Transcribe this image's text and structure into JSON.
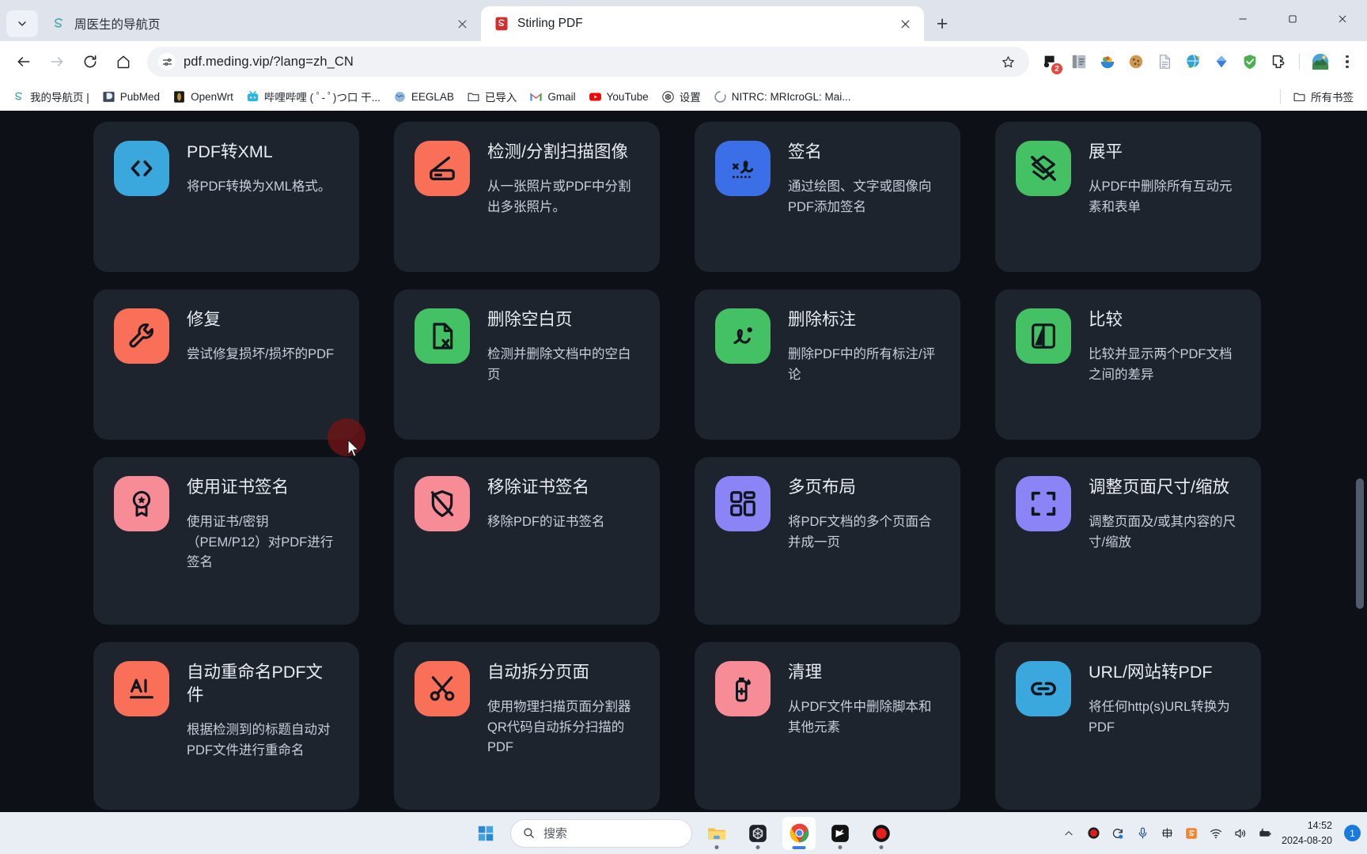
{
  "window": {
    "tabs": [
      {
        "title": "周医生的导航页",
        "favicon": "stirling-s-icon",
        "active": false
      },
      {
        "title": "Stirling PDF",
        "favicon": "stirling-pdf-icon",
        "active": true
      }
    ],
    "new_tab_label": "+",
    "controls": {
      "minimize": "minimize",
      "maximize": "maximize",
      "close": "close"
    }
  },
  "toolbar": {
    "back": "back-arrow",
    "forward": "forward-arrow",
    "reload": "reload",
    "home": "home",
    "url": "pdf.meding.vip/?lang=zh_CN",
    "site_settings_icon": "tune-icon",
    "bookmark_star": "star-icon",
    "extensions": [
      {
        "name": "downloads-badge-icon",
        "badge": "2"
      },
      {
        "name": "copy-pages-icon",
        "badge": ""
      },
      {
        "name": "fruit-bowl-icon",
        "badge": ""
      },
      {
        "name": "cookie-icon",
        "badge": ""
      },
      {
        "name": "document-icon",
        "badge": ""
      },
      {
        "name": "idm-icon",
        "badge": ""
      },
      {
        "name": "diamond-icon",
        "badge": ""
      },
      {
        "name": "adguard-shield-icon",
        "badge": ""
      },
      {
        "name": "extensions-puzzle-icon",
        "badge": ""
      },
      {
        "name": "profile-avatar",
        "badge": ""
      }
    ],
    "menu": "chrome-menu"
  },
  "bookmarks": {
    "items": [
      {
        "label": "我的导航页 |",
        "icon": "stirling-s-icon"
      },
      {
        "label": "PubMed",
        "icon": "pubmed-icon"
      },
      {
        "label": "OpenWrt",
        "icon": "openwrt-icon"
      },
      {
        "label": "哔哩哔哩 ( ﾟ- ﾟ)つ口 干...",
        "icon": "bilibili-icon"
      },
      {
        "label": "EEGLAB",
        "icon": "eeglab-icon"
      },
      {
        "label": "已导入",
        "icon": "folder-icon"
      },
      {
        "label": "Gmail",
        "icon": "gmail-icon"
      },
      {
        "label": "YouTube",
        "icon": "youtube-icon"
      },
      {
        "label": "设置",
        "icon": "openai-icon"
      },
      {
        "label": "NITRC: MRIcroGL: Mai...",
        "icon": "nitrc-icon"
      }
    ],
    "all_bookmarks": {
      "label": "所有书签",
      "icon": "folder-icon"
    }
  },
  "page": {
    "cards": [
      {
        "title": "PDF转XML",
        "desc": "将PDF转换为XML格式。",
        "icon": "code-brackets-icon",
        "color": "#3ba8dd"
      },
      {
        "title": "检测/分割扫描图像",
        "desc": "从一张照片或PDF中分割出多张照片。",
        "icon": "scanner-icon",
        "color": "#fa6f57"
      },
      {
        "title": "签名",
        "desc": "通过绘图、文字或图像向PDF添加签名",
        "icon": "signature-icon",
        "color": "#3b6fe8"
      },
      {
        "title": "展平",
        "desc": "从PDF中删除所有互动元素和表单",
        "icon": "flatten-icon",
        "color": "#43c164"
      },
      {
        "title": "修复",
        "desc": "尝试修复损坏/损坏的PDF",
        "icon": "wrench-icon",
        "color": "#fa6f57"
      },
      {
        "title": "删除空白页",
        "desc": "检测并删除文档中的空白页",
        "icon": "file-x-icon",
        "color": "#43c164"
      },
      {
        "title": "删除标注",
        "desc": "删除PDF中的所有标注/评论",
        "icon": "annotation-icon",
        "color": "#43c164"
      },
      {
        "title": "比较",
        "desc": "比较并显示两个PDF文档之间的差异",
        "icon": "compare-icon",
        "color": "#43c164"
      },
      {
        "title": "使用证书签名",
        "desc": "使用证书/密钥（PEM/P12）对PDF进行签名",
        "icon": "certificate-icon",
        "color": "#f78b96"
      },
      {
        "title": "移除证书签名",
        "desc": "移除PDF的证书签名",
        "icon": "shield-off-icon",
        "color": "#f78b96"
      },
      {
        "title": "多页布局",
        "desc": "将PDF文档的多个页面合并成一页",
        "icon": "multi-layout-icon",
        "color": "#8b84f7"
      },
      {
        "title": "调整页面尺寸/缩放",
        "desc": "调整页面及/或其内容的尺寸/缩放",
        "icon": "scale-icon",
        "color": "#8b84f7"
      },
      {
        "title": "自动重命名PDF文件",
        "desc": "根据检测到的标题自动对PDF文件进行重命名",
        "icon": "auto-rename-icon",
        "color": "#fa6f57"
      },
      {
        "title": "自动拆分页面",
        "desc": "使用物理扫描页面分割器QR代码自动拆分扫描的PDF",
        "icon": "scissors-icon",
        "color": "#fa6f57"
      },
      {
        "title": "清理",
        "desc": "从PDF文件中删除脚本和其他元素",
        "icon": "sanitize-icon",
        "color": "#f78b96"
      },
      {
        "title": "URL/网站转PDF",
        "desc": "将任何http(s)URL转换为PDF",
        "icon": "link-icon",
        "color": "#3ba8dd"
      }
    ],
    "background": "#0d1117",
    "card_background": "#1e242e"
  },
  "taskbar": {
    "start": "windows-start-icon",
    "search_placeholder": "搜索",
    "apps": [
      {
        "name": "file-explorer-icon",
        "state": "open"
      },
      {
        "name": "app-dark-icon",
        "state": "open"
      },
      {
        "name": "chrome-icon",
        "state": "active"
      },
      {
        "name": "capcut-icon",
        "state": "open"
      },
      {
        "name": "record-icon",
        "state": "open"
      }
    ],
    "tray": [
      {
        "name": "chevron-up-icon"
      },
      {
        "name": "record-red-icon"
      },
      {
        "name": "sync-icon"
      },
      {
        "name": "microphone-icon"
      },
      {
        "name": "ime-chinese-icon"
      },
      {
        "name": "sogou-icon"
      },
      {
        "name": "wifi-icon"
      },
      {
        "name": "volume-icon"
      },
      {
        "name": "battery-icon"
      }
    ],
    "time": "14:52",
    "date": "2024-08-20",
    "notification_count": "1"
  }
}
